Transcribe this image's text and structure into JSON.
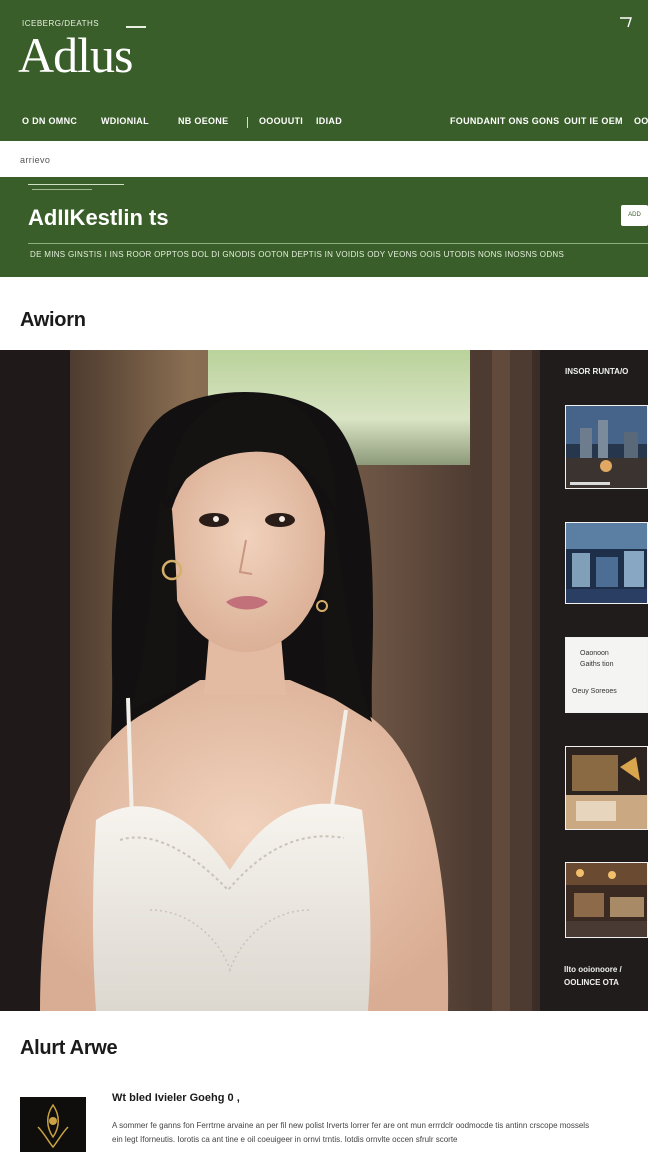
{
  "header": {
    "kicker": "ICEBERG/DEATHS",
    "logo": "Adlus",
    "nav": [
      "O DN OMNC",
      "WDIONIAL",
      "NB OEONE",
      "OOOUUTI",
      "IDIAD",
      "FOUNDANIT ONS GONS",
      "OUIT IE OEM",
      "OO"
    ]
  },
  "breadcrumb": "arrievo",
  "banner": {
    "title": "AdIIKestlin ts",
    "tag_label": "ADD",
    "subnav": "DE MINS GINSTIS I INS ROOR OPPTOS DOL DI GNODIS OOTON DEPTIS IN VOIDIS ODY VEONS OOIS UTODIS NONS INOSNS ODNS"
  },
  "section_heading": "Awiorn",
  "gallery": {
    "side_title": "INSOR RUNTA/O",
    "thumb_card_text": {
      "line1": "Oaonoon",
      "line2": "Gaiths tion",
      "line3": "Oeuy Soreoes"
    },
    "side_footer": {
      "line1": "Ilto ooionoore /",
      "line2": "OOLINCE OTA"
    }
  },
  "about": {
    "heading": "Alurt Arwe",
    "title": "Wt bled Ivieler Goehg 0 ,",
    "body": "A sommer fe ganns fon Ferrtrne arvaine an per fil new polist Irverts lorrer fer are ont mun errrdclr oodmocde tis antinn crscope mossels ein legt Iforneutis. Iorotis ca ant tine e oil coeuigeer in ornvi trntis. Iotdis ornvlte occen sfrulr scorte"
  },
  "colors": {
    "brand_green": "#3a5e2a",
    "gallery_bg": "#1b1818"
  }
}
